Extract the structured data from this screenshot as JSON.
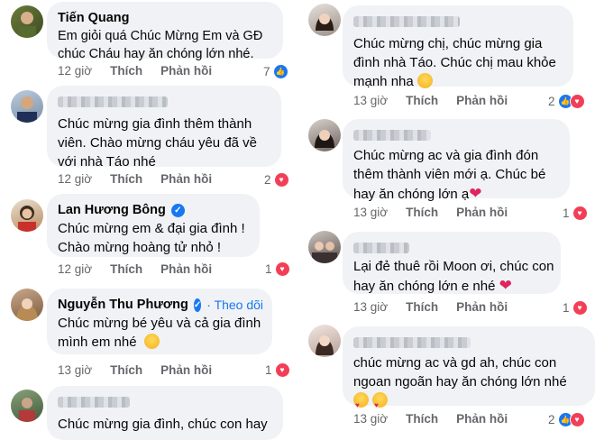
{
  "colors": {
    "bubble": "#f0f2f5",
    "meta_text": "#65676b",
    "link_blue": "#1877f2",
    "like_blue": "#1877f2",
    "love_red": "#f33e58"
  },
  "actions": {
    "like_label": "Thích",
    "reply_label": "Phản hồi"
  },
  "left_comments": [
    {
      "author": "Tiến Quang",
      "verified": false,
      "follow": "",
      "text": "Em giỏi quá Chúc Mừng Em và GĐ chúc Cháu hay ăn chóng lớn nhé.",
      "time": "12 giờ",
      "reaction_count": "7",
      "reactions": [
        "like-icon"
      ]
    },
    {
      "author": "",
      "verified": false,
      "follow": "",
      "text": "Chúc mừng gia đình thêm thành viên. Chào mừng cháu yêu đã về với nhà Táo nhé",
      "time": "12 giờ",
      "reaction_count": "2",
      "reactions": [
        "love-icon"
      ]
    },
    {
      "author": "Lan Hương Bông",
      "verified": true,
      "follow": "",
      "text": "Chúc mừng em & đại gia đình ! Chào mừng hoàng tử nhỏ !",
      "time": "12 giờ",
      "reaction_count": "1",
      "reactions": [
        "love-icon"
      ]
    },
    {
      "author": "Nguyễn Thu Phương",
      "verified": true,
      "follow": "Theo dõi",
      "text": "Chúc mừng bé yêu và cả gia đình mình em nhé",
      "time": "13 giờ",
      "reaction_count": "1",
      "reactions": [
        "love-icon"
      ]
    },
    {
      "author": "",
      "verified": false,
      "follow": "",
      "text": "Chúc mừng gia đình, chúc con hay",
      "time": "",
      "reaction_count": "",
      "reactions": []
    }
  ],
  "right_comments": [
    {
      "author": "",
      "text": "Chúc mừng chị, chúc mừng gia đình nhà Táo. Chúc chị mau khỏe mạnh nha",
      "time": "13 giờ",
      "reaction_count": "2",
      "reactions": [
        "like-icon",
        "love-icon"
      ]
    },
    {
      "author": "",
      "text": "Chúc mừng ac và gia đình đón thêm thành viên mới ạ. Chúc bé hay ăn chóng lớn ạ",
      "time": "13 giờ",
      "reaction_count": "1",
      "reactions": [
        "love-icon"
      ]
    },
    {
      "author": "",
      "text": "Lại đẻ thuê rồi Moon ơi, chúc con hay ăn chóng lớn e nhé",
      "time": "13 giờ",
      "reaction_count": "1",
      "reactions": [
        "love-icon"
      ]
    },
    {
      "author": "",
      "text": "chúc mừng ac và gd ah, chúc con ngoan ngoãn hay ăn chóng lớn nhé",
      "time": "13 giờ",
      "reaction_count": "2",
      "reactions": [
        "like-icon",
        "love-icon"
      ]
    }
  ]
}
